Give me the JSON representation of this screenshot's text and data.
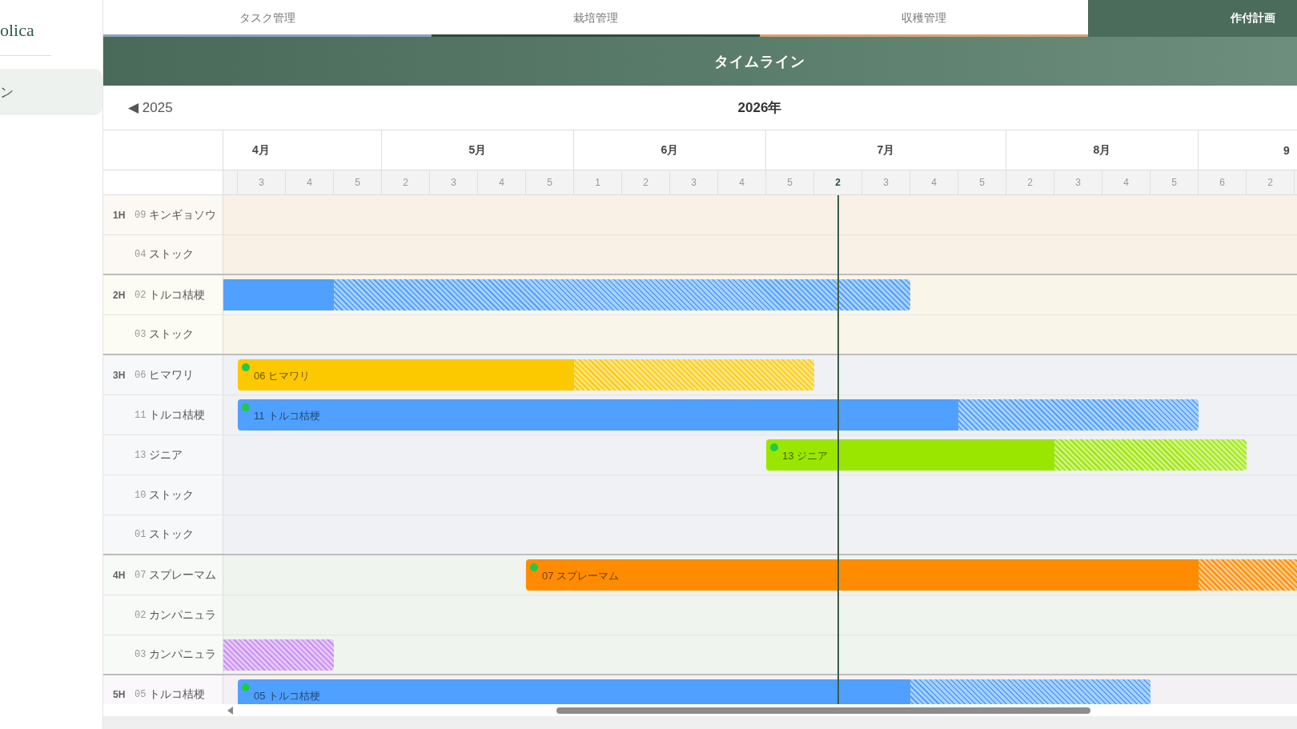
{
  "sidebar": {
    "brand": "olica",
    "items": [
      {
        "label": "ン",
        "selected": true
      }
    ]
  },
  "tabs": [
    {
      "label": "タスク管理",
      "selected": false,
      "color": "#8fa3ba"
    },
    {
      "label": "栽培管理",
      "selected": false,
      "color": "#2f4a3c"
    },
    {
      "label": "収穫管理",
      "selected": false,
      "color": "#d9a373"
    },
    {
      "label": "作付計画",
      "selected": true,
      "color": "#4b6b5b"
    }
  ],
  "header": {
    "title": "タイムライン"
  },
  "year_nav": {
    "previous": "◀ 2025",
    "current": "2026年"
  },
  "months": [
    {
      "label": "4月",
      "weeks": [
        {
          "label": "3",
          "current": false
        },
        {
          "label": "4",
          "current": false
        },
        {
          "label": "5",
          "current": false
        }
      ]
    },
    {
      "label": "5月",
      "weeks": [
        {
          "label": "2",
          "current": false
        },
        {
          "label": "3",
          "current": false
        },
        {
          "label": "4",
          "current": false
        },
        {
          "label": "5",
          "current": false
        }
      ]
    },
    {
      "label": "6月",
      "weeks": [
        {
          "label": "1",
          "current": false
        },
        {
          "label": "2",
          "current": false
        },
        {
          "label": "3",
          "current": false
        },
        {
          "label": "4",
          "current": false
        }
      ]
    },
    {
      "label": "7月",
      "weeks": [
        {
          "label": "5",
          "current": false
        },
        {
          "label": "2",
          "current": true
        },
        {
          "label": "3",
          "current": false
        },
        {
          "label": "4",
          "current": false
        },
        {
          "label": "5",
          "current": false
        }
      ]
    },
    {
      "label": "8月",
      "weeks": [
        {
          "label": "2",
          "current": false
        },
        {
          "label": "3",
          "current": false
        },
        {
          "label": "4",
          "current": false
        },
        {
          "label": "5",
          "current": false
        }
      ]
    },
    {
      "label": "9",
      "weeks": [
        {
          "label": "6",
          "current": false
        },
        {
          "label": "2",
          "current": false
        }
      ]
    }
  ],
  "groups": [
    {
      "label": "1H",
      "color": "#f9f0e6",
      "rows": [
        {
          "number": "09",
          "name": "キンギョソウ"
        },
        {
          "number": "04",
          "name": "ストック"
        }
      ]
    },
    {
      "label": "2H",
      "color": "#f9f6e9",
      "rows": [
        {
          "number": "02",
          "name": "トルコ桔梗",
          "bar": {
            "color": "#50a0ff",
            "status_dot": false,
            "cells": [
              {
                "kind": "actual"
              },
              {
                "kind": "actual"
              },
              {
                "kind": "actual"
              },
              {
                "kind": "plan"
              },
              {
                "kind": "plan"
              },
              {
                "kind": "plan"
              },
              {
                "kind": "plan"
              },
              {
                "kind": "plan"
              },
              {
                "kind": "plan"
              },
              {
                "kind": "plan"
              },
              {
                "kind": "plan"
              },
              {
                "kind": "plan"
              },
              {
                "kind": "plan"
              },
              {
                "kind": "plan"
              },
              {
                "kind": "plan"
              },
              {
                "kind": "none"
              },
              {
                "kind": "none"
              },
              {
                "kind": "none"
              },
              {
                "kind": "none"
              },
              {
                "kind": "none"
              },
              {
                "kind": "none"
              },
              {
                "kind": "none"
              },
              {
                "kind": "none"
              },
              {
                "kind": "none"
              }
            ]
          }
        },
        {
          "number": "03",
          "name": "ストック"
        }
      ]
    },
    {
      "label": "3H",
      "color": "#eff1f4",
      "rows": [
        {
          "number": "06",
          "name": "ヒマワリ",
          "bar": {
            "number": "06",
            "name": "ヒマワリ",
            "color": "#fcc800",
            "status_dot": true,
            "cells": [
              {
                "kind": "none"
              },
              {
                "kind": "actual"
              },
              {
                "kind": "actual"
              },
              {
                "kind": "actual"
              },
              {
                "kind": "actual"
              },
              {
                "kind": "actual"
              },
              {
                "kind": "actual"
              },
              {
                "kind": "actual"
              },
              {
                "kind": "plan"
              },
              {
                "kind": "plan"
              },
              {
                "kind": "plan"
              },
              {
                "kind": "plan"
              },
              {
                "kind": "plan"
              },
              {
                "kind": "none"
              },
              {
                "kind": "none"
              },
              {
                "kind": "none"
              },
              {
                "kind": "none"
              },
              {
                "kind": "none"
              },
              {
                "kind": "none"
              },
              {
                "kind": "none"
              },
              {
                "kind": "none"
              },
              {
                "kind": "none"
              },
              {
                "kind": "none"
              },
              {
                "kind": "none"
              }
            ]
          }
        },
        {
          "number": "11",
          "name": "トルコ桔梗",
          "bar": {
            "number": "11",
            "name": "トルコ桔梗",
            "color": "#50a0ff",
            "status_dot": true,
            "cells": [
              {
                "kind": "none"
              },
              {
                "kind": "actual"
              },
              {
                "kind": "actual"
              },
              {
                "kind": "actual"
              },
              {
                "kind": "actual"
              },
              {
                "kind": "actual"
              },
              {
                "kind": "actual"
              },
              {
                "kind": "actual"
              },
              {
                "kind": "actual"
              },
              {
                "kind": "actual"
              },
              {
                "kind": "actual"
              },
              {
                "kind": "actual"
              },
              {
                "kind": "actual"
              },
              {
                "kind": "actual"
              },
              {
                "kind": "actual"
              },
              {
                "kind": "actual"
              },
              {
                "kind": "plan"
              },
              {
                "kind": "plan"
              },
              {
                "kind": "plan"
              },
              {
                "kind": "plan"
              },
              {
                "kind": "plan"
              },
              {
                "kind": "none"
              },
              {
                "kind": "none"
              },
              {
                "kind": "none"
              }
            ]
          }
        },
        {
          "number": "13",
          "name": "ジニア",
          "bar": {
            "number": "13",
            "name": "ジニア",
            "color": "#9be600",
            "status_dot": true,
            "cells": [
              {
                "kind": "none"
              },
              {
                "kind": "none"
              },
              {
                "kind": "none"
              },
              {
                "kind": "none"
              },
              {
                "kind": "none"
              },
              {
                "kind": "none"
              },
              {
                "kind": "none"
              },
              {
                "kind": "none"
              },
              {
                "kind": "none"
              },
              {
                "kind": "none"
              },
              {
                "kind": "none"
              },
              {
                "kind": "none"
              },
              {
                "kind": "actual"
              },
              {
                "kind": "actual"
              },
              {
                "kind": "actual"
              },
              {
                "kind": "actual"
              },
              {
                "kind": "actual"
              },
              {
                "kind": "actual"
              },
              {
                "kind": "plan"
              },
              {
                "kind": "plan"
              },
              {
                "kind": "plan"
              },
              {
                "kind": "plan"
              },
              {
                "kind": "none"
              },
              {
                "kind": "none"
              }
            ]
          }
        },
        {
          "number": "10",
          "name": "ストック"
        },
        {
          "number": "01",
          "name": "ストック"
        }
      ]
    },
    {
      "label": "4H",
      "color": "#eff4ee",
      "rows": [
        {
          "number": "07",
          "name": "スプレーマム",
          "bar": {
            "number": "07",
            "name": "スプレーマム",
            "color": "#ff8c00",
            "status_dot": true,
            "cells": [
              {
                "kind": "none"
              },
              {
                "kind": "none"
              },
              {
                "kind": "none"
              },
              {
                "kind": "none"
              },
              {
                "kind": "none"
              },
              {
                "kind": "none"
              },
              {
                "kind": "none"
              },
              {
                "kind": "actual"
              },
              {
                "kind": "actual"
              },
              {
                "kind": "actual"
              },
              {
                "kind": "actual"
              },
              {
                "kind": "actual"
              },
              {
                "kind": "actual"
              },
              {
                "kind": "actual"
              },
              {
                "kind": "actual"
              },
              {
                "kind": "actual"
              },
              {
                "kind": "actual"
              },
              {
                "kind": "actual"
              },
              {
                "kind": "actual"
              },
              {
                "kind": "actual"
              },
              {
                "kind": "actual"
              },
              {
                "kind": "plan"
              },
              {
                "kind": "plan"
              },
              {
                "kind": "plan"
              }
            ]
          }
        },
        {
          "number": "02",
          "name": "カンパニュラ"
        },
        {
          "number": "03",
          "name": "カンパニュラ",
          "bar": {
            "color": "#c98ff2",
            "status_dot": false,
            "cells": [
              {
                "kind": "plan"
              },
              {
                "kind": "plan"
              },
              {
                "kind": "plan"
              },
              {
                "kind": "none"
              },
              {
                "kind": "none"
              },
              {
                "kind": "none"
              },
              {
                "kind": "none"
              },
              {
                "kind": "none"
              },
              {
                "kind": "none"
              },
              {
                "kind": "none"
              },
              {
                "kind": "none"
              },
              {
                "kind": "none"
              },
              {
                "kind": "none"
              },
              {
                "kind": "none"
              },
              {
                "kind": "none"
              },
              {
                "kind": "none"
              },
              {
                "kind": "none"
              },
              {
                "kind": "none"
              },
              {
                "kind": "none"
              },
              {
                "kind": "none"
              },
              {
                "kind": "none"
              },
              {
                "kind": "none"
              },
              {
                "kind": "none"
              },
              {
                "kind": "none"
              }
            ]
          }
        }
      ]
    },
    {
      "label": "5H",
      "color": "#f4f1f5",
      "rows": [
        {
          "number": "05",
          "name": "トルコ桔梗",
          "bar": {
            "number": "05",
            "name": "トルコ桔梗",
            "color": "#50a0ff",
            "status_dot": true,
            "cells": [
              {
                "kind": "none"
              },
              {
                "kind": "actual"
              },
              {
                "kind": "actual"
              },
              {
                "kind": "actual"
              },
              {
                "kind": "actual"
              },
              {
                "kind": "actual"
              },
              {
                "kind": "actual"
              },
              {
                "kind": "actual"
              },
              {
                "kind": "actual"
              },
              {
                "kind": "actual"
              },
              {
                "kind": "actual"
              },
              {
                "kind": "actual"
              },
              {
                "kind": "actual"
              },
              {
                "kind": "actual"
              },
              {
                "kind": "actual"
              },
              {
                "kind": "plan"
              },
              {
                "kind": "plan"
              },
              {
                "kind": "plan"
              },
              {
                "kind": "plan"
              },
              {
                "kind": "plan"
              },
              {
                "kind": "none"
              },
              {
                "kind": "none"
              },
              {
                "kind": "none"
              },
              {
                "kind": "none"
              }
            ]
          }
        }
      ]
    }
  ]
}
